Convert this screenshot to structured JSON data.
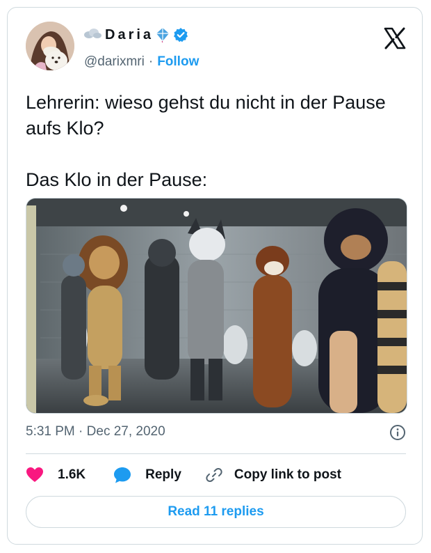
{
  "author": {
    "display_name": "Daria",
    "handle": "@darixmri",
    "separator": "·",
    "follow_label": "Follow"
  },
  "tweet": {
    "lines": [
      "Lehrerin: wieso gehst du nicht in der Pause aufs Klo?",
      "Das Klo in der Pause:"
    ]
  },
  "meta": {
    "time": "5:31 PM",
    "separator": "·",
    "date": "Dec 27, 2020"
  },
  "actions": {
    "likes": "1.6K",
    "reply_label": "Reply",
    "copy_label": "Copy link to post"
  },
  "read_replies_label": "Read 11 replies",
  "colors": {
    "accent": "#1d9bf0",
    "like": "#f91880",
    "text": "#0f1419",
    "muted": "#536471",
    "border": "#cfd9de"
  },
  "icons": [
    "x-logo-icon",
    "verified-badge-icon",
    "kite-icon",
    "cloud-icon",
    "info-icon",
    "heart-icon",
    "reply-bubble-icon",
    "link-icon"
  ]
}
